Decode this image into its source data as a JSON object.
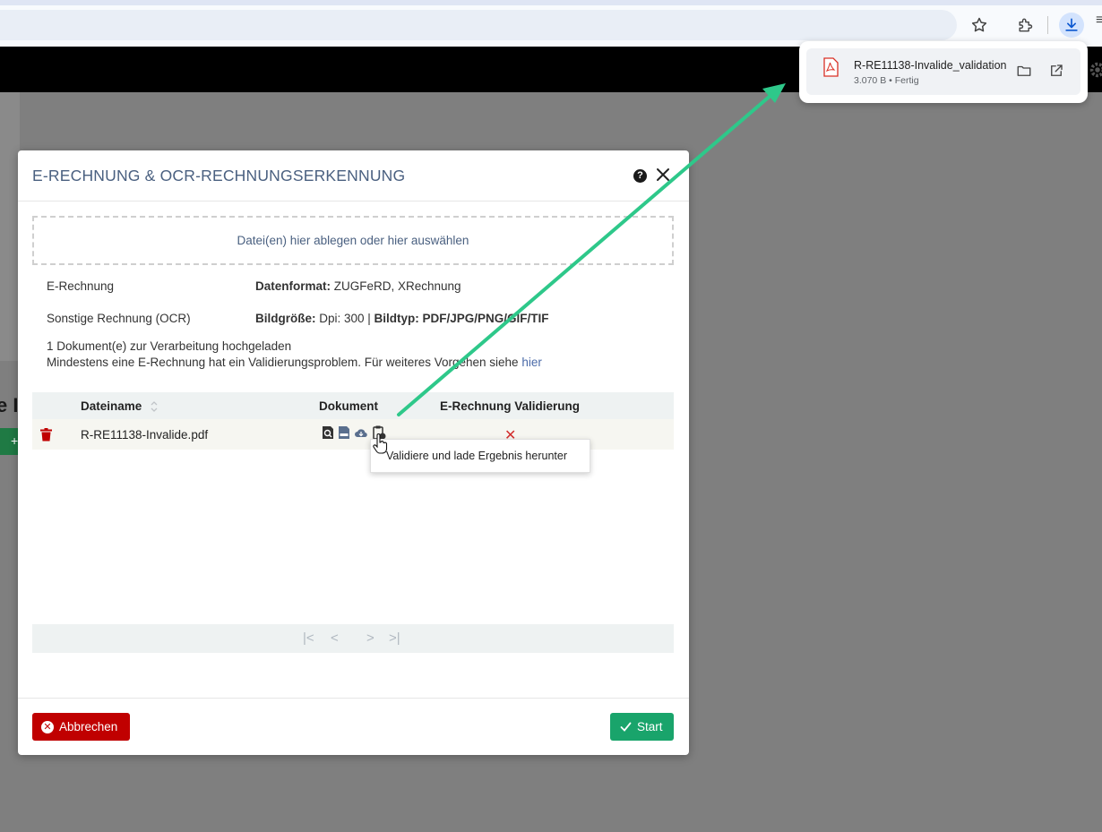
{
  "browser": {
    "icons": [
      "star-icon",
      "extensions-icon",
      "download-icon",
      "menu-icon"
    ]
  },
  "download": {
    "filename": "R-RE11138-Invalide_validation",
    "status": "3.070 B • Fertig"
  },
  "app": {
    "left_text": "e I",
    "left_button": "+"
  },
  "modal": {
    "title": "E-RECHNUNG & OCR-RECHNUNGSERKENNUNG",
    "help": "?",
    "dropzone": "Datei(en) hier ablegen oder hier auswählen",
    "info": [
      {
        "label": "E-Rechnung",
        "key": "Datenformat:",
        "value": " ZUGFeRD, XRechnung",
        "key2": "",
        "value2": ""
      },
      {
        "label": "Sonstige Rechnung (OCR)",
        "key": "Bildgröße:",
        "value": " Dpi: 300 | ",
        "key2": "Bildtyp: PDF/JPG/PNG/GIF/TIF",
        "value2": ""
      }
    ],
    "upload_line1": "1 Dokument(e) zur Verarbeitung hochgeladen",
    "upload_line2": "Mindestens eine E-Rechnung hat ein Validierungsproblem. Für weiteres Vorgehen siehe ",
    "upload_link": "hier",
    "table": {
      "col_filename": "Dateiname",
      "col_document": "Dokument",
      "col_validation": "E-Rechnung Validierung",
      "rows": [
        {
          "filename": "R-RE11138-Invalide.pdf",
          "validation": "✕"
        }
      ]
    },
    "tooltip": "Validiere und lade Ergebnis herunter",
    "pager": {
      "first": "|<",
      "prev": "<",
      "next": ">",
      "last": ">|"
    },
    "cancel_label": "Abbrechen",
    "start_label": "Start"
  },
  "colors": {
    "accent_title": "#4a6080",
    "cancel": "#c00000",
    "start": "#19a46b",
    "arrow": "#2ec88a"
  }
}
